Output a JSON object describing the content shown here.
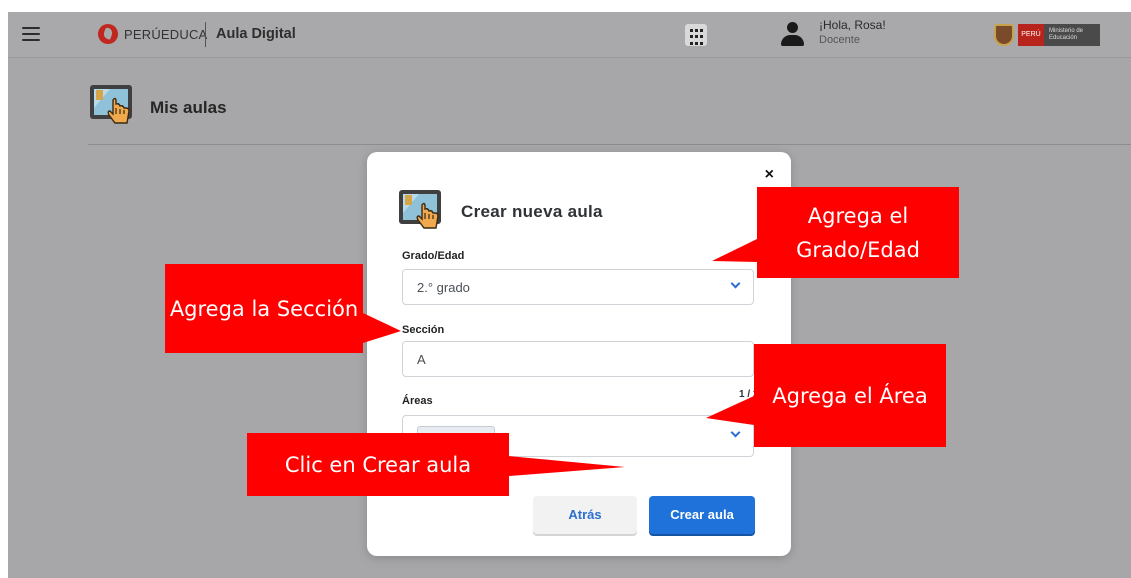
{
  "header": {
    "brand_name": "PERÚEDUCA",
    "app_name": "Aula Digital",
    "greeting": "¡Hola, Rosa!",
    "role": "Docente",
    "gov_logo": {
      "flag_text": "PERÚ",
      "ministry_text": "Ministerio de Educación"
    }
  },
  "page": {
    "title": "Mis aulas"
  },
  "modal": {
    "title": "Crear nueva aula",
    "close_label": "×",
    "grade": {
      "label": "Grado/Edad",
      "value": "2.° grado"
    },
    "section": {
      "label": "Sección",
      "value": "A",
      "counter": "1 / 20"
    },
    "areas": {
      "label": "Áreas",
      "value": ""
    },
    "back_label": "Atrás",
    "create_label": "Crear aula"
  },
  "annotations": {
    "grade": "Agrega el Grado/Edad",
    "section": "Agrega la Sección",
    "area": "Agrega el Área",
    "create": "Clic en Crear aula"
  },
  "colors": {
    "callout": "#ff0000",
    "primary": "#1f72d9",
    "overlay": "#a7a7a9"
  }
}
